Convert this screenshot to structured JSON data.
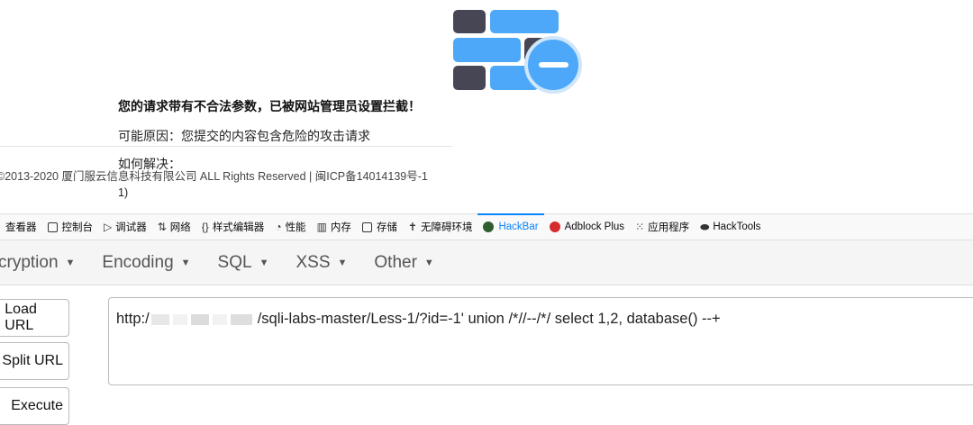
{
  "block_page": {
    "title": "您的请求带有不合法参数，已被网站管理员设置拦截！",
    "reason": "可能原因：您提交的内容包含危险的攻击请求",
    "howto": "如何解决：",
    "copyright_line1": "©2013-2020 厦门服云信息科技有限公司 ALL Rights Reserved | 闽ICP备14014139号-1",
    "copyright_line2": "1)"
  },
  "devtools_tabs": [
    {
      "label": "查看器",
      "icon": "inspector-icon"
    },
    {
      "label": "控制台",
      "icon": "console-icon"
    },
    {
      "label": "调试器",
      "icon": "debugger-icon"
    },
    {
      "label": "网络",
      "icon": "network-icon"
    },
    {
      "label": "样式编辑器",
      "icon": "style-editor-icon"
    },
    {
      "label": "性能",
      "icon": "performance-icon"
    },
    {
      "label": "内存",
      "icon": "memory-icon"
    },
    {
      "label": "存储",
      "icon": "storage-icon"
    },
    {
      "label": "无障碍环境",
      "icon": "accessibility-icon"
    },
    {
      "label": "HackBar",
      "icon": "hackbar-icon",
      "active": true
    },
    {
      "label": "Adblock Plus",
      "icon": "adblock-icon"
    },
    {
      "label": "应用程序",
      "icon": "application-icon"
    },
    {
      "label": "HackTools",
      "icon": "hacktools-icon"
    }
  ],
  "hackbar": {
    "menu": [
      "cryption",
      "Encoding",
      "SQL",
      "XSS",
      "Other"
    ],
    "buttons": {
      "load": "Load URL",
      "split": "Split URL",
      "execute": "Execute"
    },
    "url_prefix": "http:/",
    "url_suffix": "/sqli-labs-master/Less-1/?id=-1' union /*//--/*/ select 1,2, database() --+"
  },
  "colors": {
    "brick_dark": "#474655",
    "brick_blue": "#4da8f9",
    "accent": "#0a84ff"
  }
}
